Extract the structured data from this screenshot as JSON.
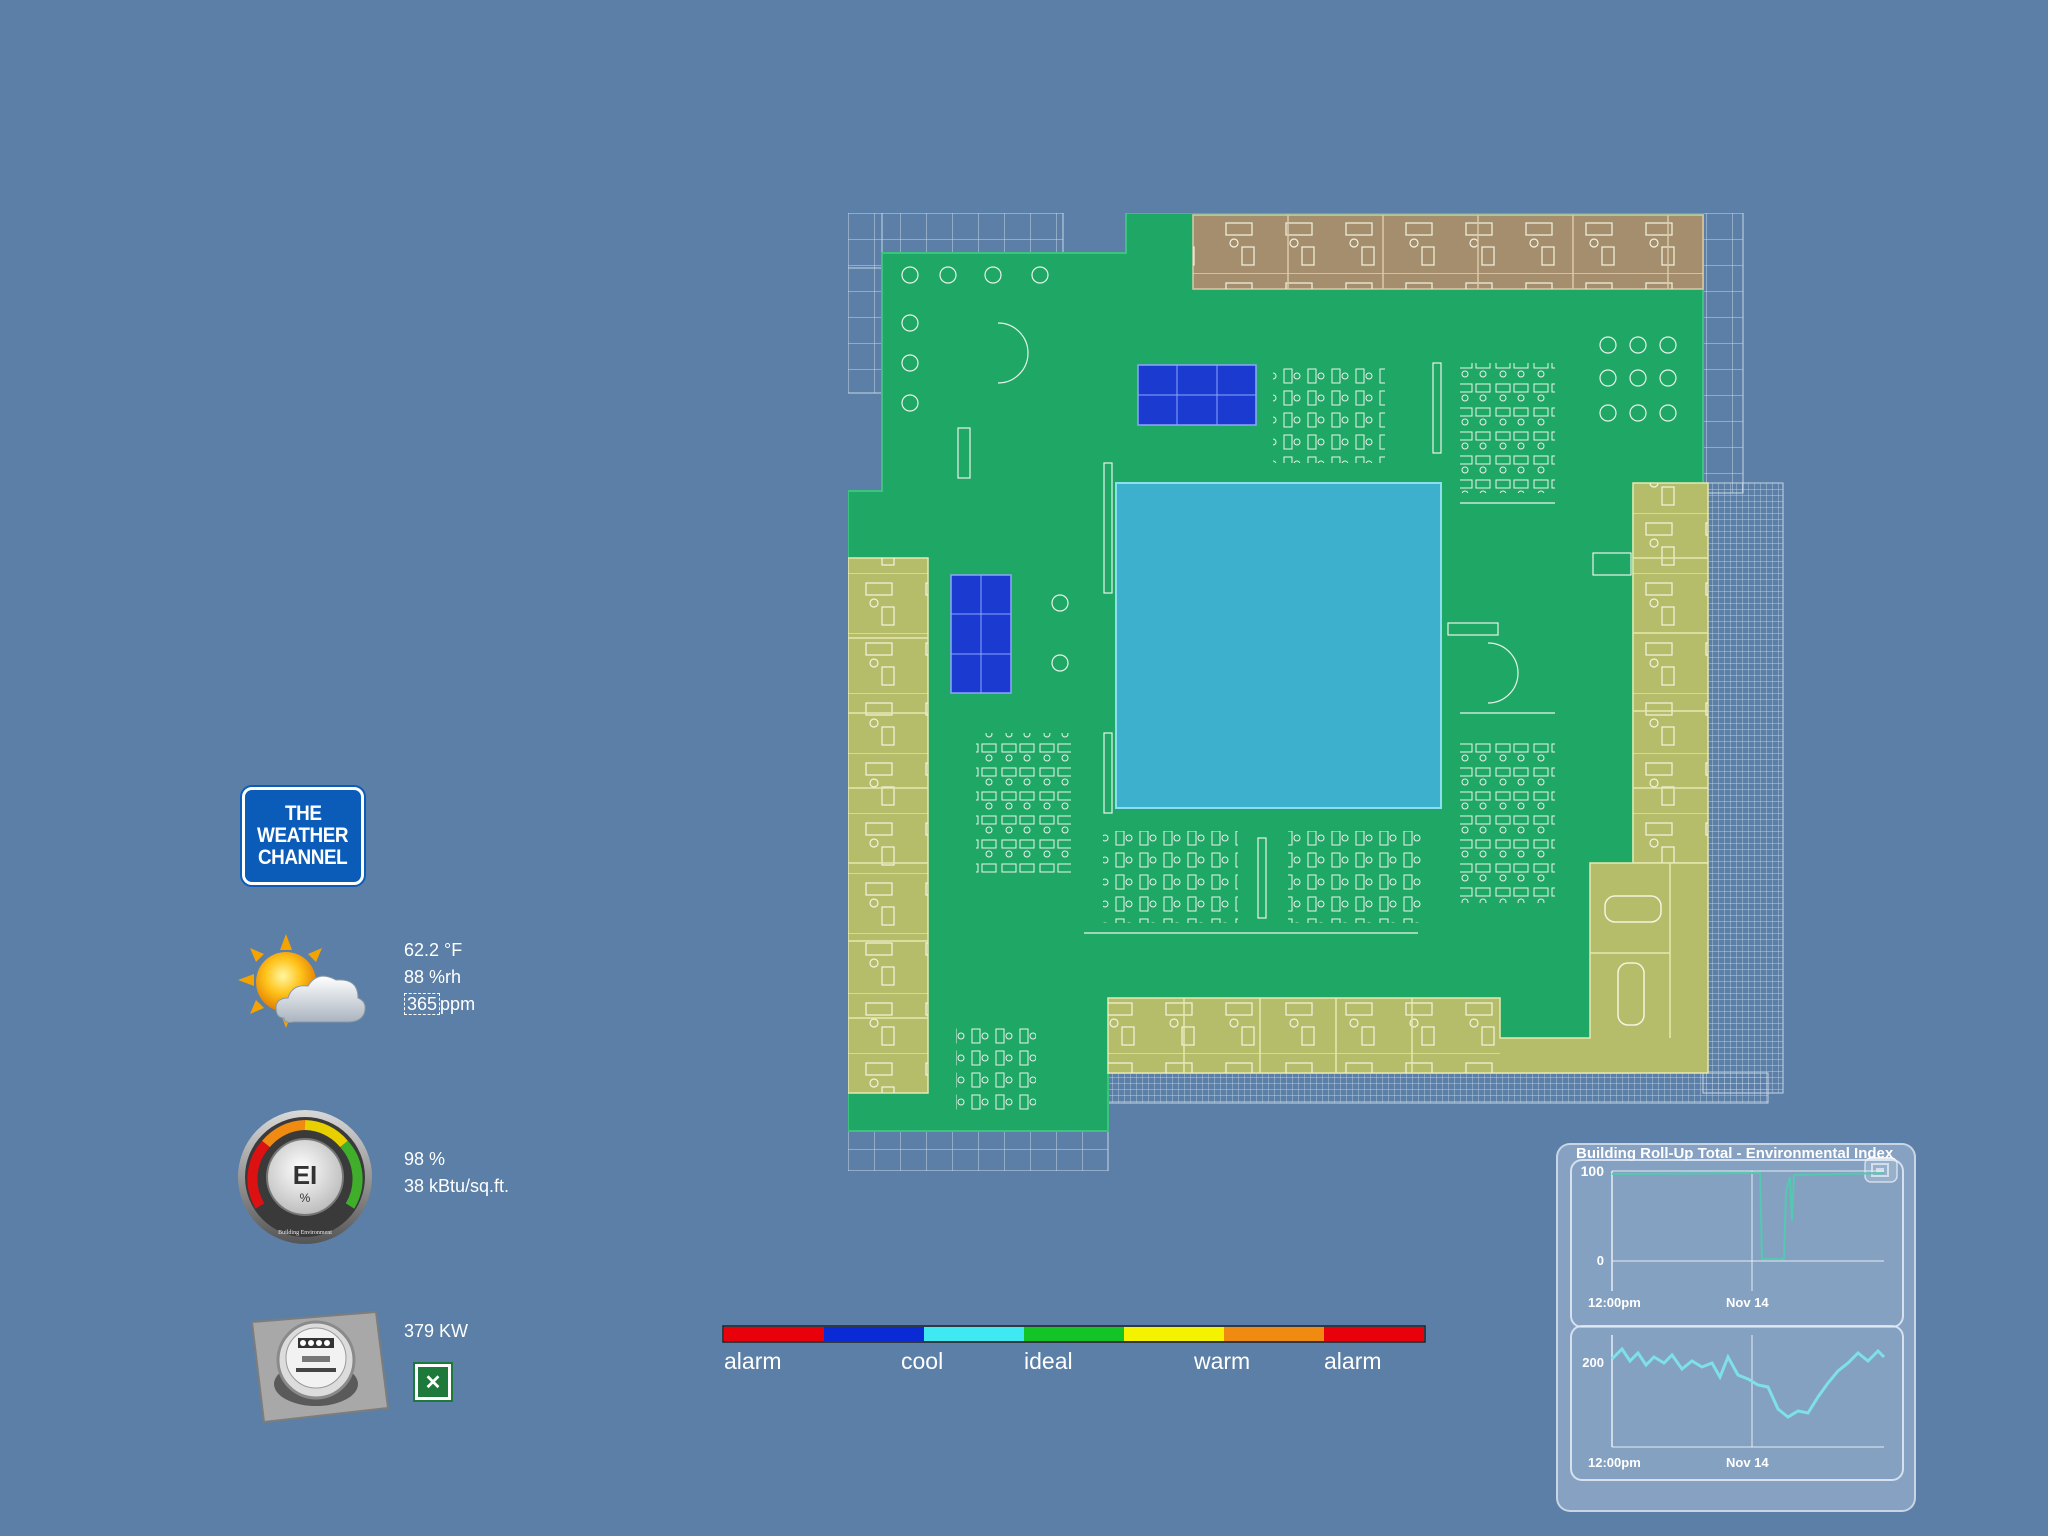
{
  "weather_logo": {
    "line1": "THE",
    "line2": "WEATHER",
    "line3": "CHANNEL"
  },
  "weather": {
    "temperature": "62.2 °F",
    "humidity": "88 %rh",
    "co2_value": "365",
    "co2_unit": "ppm"
  },
  "environment_index": {
    "gauge_label": "EI",
    "gauge_unit": "%",
    "gauge_caption": "Building Environment",
    "percent": "98 %",
    "energy": "38 kBtu/sq.ft."
  },
  "power": {
    "demand": "379 KW"
  },
  "legend": {
    "colors": [
      "#e8000b",
      "#0a2ad6",
      "#3fe9f2",
      "#12c425",
      "#f5f200",
      "#f08a10",
      "#e8000b"
    ],
    "labels": [
      "alarm",
      "cool",
      "ideal",
      "warm",
      "alarm"
    ]
  },
  "trend": {
    "title": "Building Roll-Up Total - Environmental Index",
    "chart1": {
      "y_top": "100",
      "y_bottom": "0",
      "x_start": "12:00pm",
      "x_mid": "Nov 14"
    },
    "chart2": {
      "y_label": "200",
      "x_start": "12:00pm",
      "x_mid": "Nov 14"
    }
  },
  "colors": {
    "background": "#5b7fa6",
    "ideal_zone": "#1fa865",
    "warm_zone": "#b5bc6a",
    "cool_zone": "#3cb0cc",
    "cold_zone": "#1a3ad0",
    "brown_zone": "#a48e6d"
  }
}
